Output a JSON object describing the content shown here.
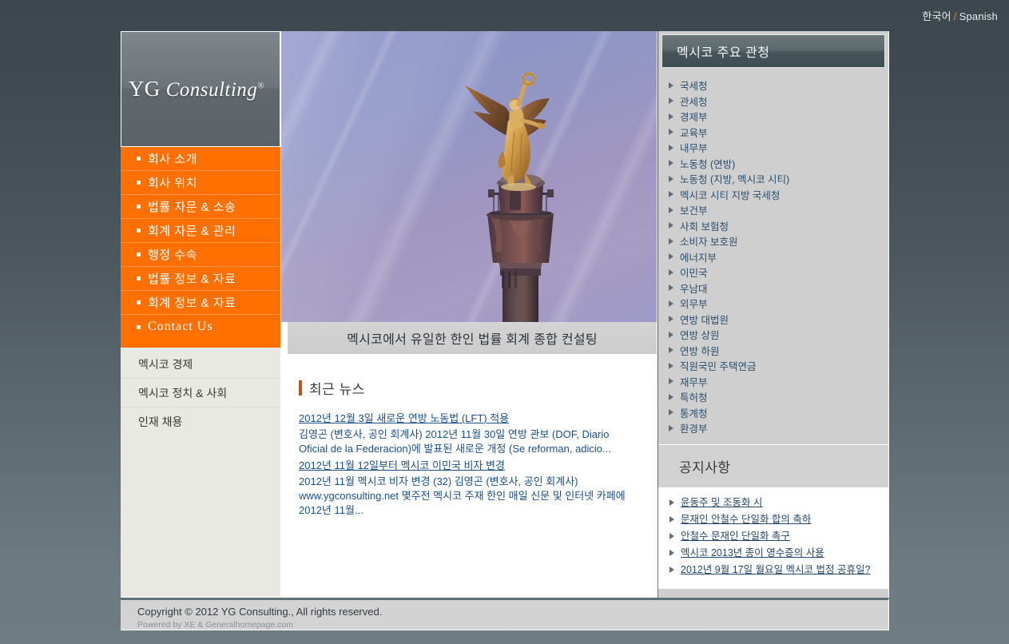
{
  "topbar": {
    "lang_korean": "한국어",
    "lang_separator": "/",
    "lang_spanish": "Spanish"
  },
  "logo": {
    "brand_yg": "YG",
    "brand_consulting": "Consulting",
    "registered_mark": "®"
  },
  "main_menu": [
    {
      "label": "회사 소개"
    },
    {
      "label": "회사 위치"
    },
    {
      "label": "법률 자문 & 소송"
    },
    {
      "label": "회계 자문 & 관리"
    },
    {
      "label": "행정 수속"
    },
    {
      "label": "법률 정보 & 자료"
    },
    {
      "label": "회계 정보 & 자료"
    },
    {
      "label": "Contact Us"
    }
  ],
  "sub_menu": [
    {
      "label": "멕시코 경제"
    },
    {
      "label": "멕시코 정치 & 사회"
    },
    {
      "label": "인재 채용"
    }
  ],
  "hero": {
    "image_alt": "angel-of-independence-monument",
    "tagline": "멕시코에서 유일한 한인 법률 회계 종합 컨설팅"
  },
  "news": {
    "heading": "최근 뉴스",
    "items": [
      {
        "title": "2012년 12월 3일 새로운 연방 노동법 (LFT) 적용",
        "body": "김영곤 (변호사, 공인 회계사) 2012년 11월 30일 연방 관보 (DOF, Diario Oficial de la Federacion)에 발표된 새로운 개정 (Se reforman, adicio..."
      },
      {
        "title": "2012년 11월 12일부터 멕시코 이민국 비자 변경",
        "body_pre": "2012년 11월 멕시코 비자 변경 (32) 김영곤 (변호사, 공인 회계사) ",
        "body_url": "www.ygconsulting.net",
        "body_post": " 몇주전 멕시코 주재 한인 매일 신문 및 인터넷 카페에 2012년 11월..."
      }
    ]
  },
  "gov_panel": {
    "heading": "멕시코 주요 관청",
    "items": [
      {
        "label": "국세청"
      },
      {
        "label": "관세청"
      },
      {
        "label": "경제부"
      },
      {
        "label": "교육부"
      },
      {
        "label": "내무부"
      },
      {
        "label": "노동청 (연방)"
      },
      {
        "label": "노동청 (지방, 멕시코 시티)"
      },
      {
        "label": "멕시코 시티 지방 국세청"
      },
      {
        "label": "보건부"
      },
      {
        "label": "사회 보험청"
      },
      {
        "label": "소비자 보호원"
      },
      {
        "label": "에너지부"
      },
      {
        "label": "이민국"
      },
      {
        "label": "우남대"
      },
      {
        "label": "외무부"
      },
      {
        "label": "연방 대법원"
      },
      {
        "label": "연방 상원"
      },
      {
        "label": "연방 하원"
      },
      {
        "label": "직원국민 주택연금"
      },
      {
        "label": "재무부"
      },
      {
        "label": "특허청"
      },
      {
        "label": "통계청"
      },
      {
        "label": "환경부"
      }
    ]
  },
  "notice_panel": {
    "heading": "공지사항",
    "items": [
      {
        "label": "윤동주 및 조동화 시"
      },
      {
        "label": "문재인 안철수 단일화 합의 축하"
      },
      {
        "label": "안철수 문재인 단일화 촉구"
      },
      {
        "label": "멕시코 2013년 종이 영수증의 사용"
      },
      {
        "label": "2012년 9월 17일 월요일 멕시코 법정 공휴일?"
      }
    ]
  },
  "footer": {
    "copyright": "Copyright © 2012 YG Consulting., All rights reserved.",
    "powered_by": "Powered by XE & Generalhomepage.com"
  },
  "colors": {
    "accent_orange": "#ff7000",
    "link_blue": "#1c4f86",
    "gov_link_blue": "#2c4f6e",
    "panel_dark": "#46555a",
    "page_bg_top": "#3c474e",
    "page_bg_bottom": "#6e7d82",
    "news_accent": "#c2511d"
  }
}
